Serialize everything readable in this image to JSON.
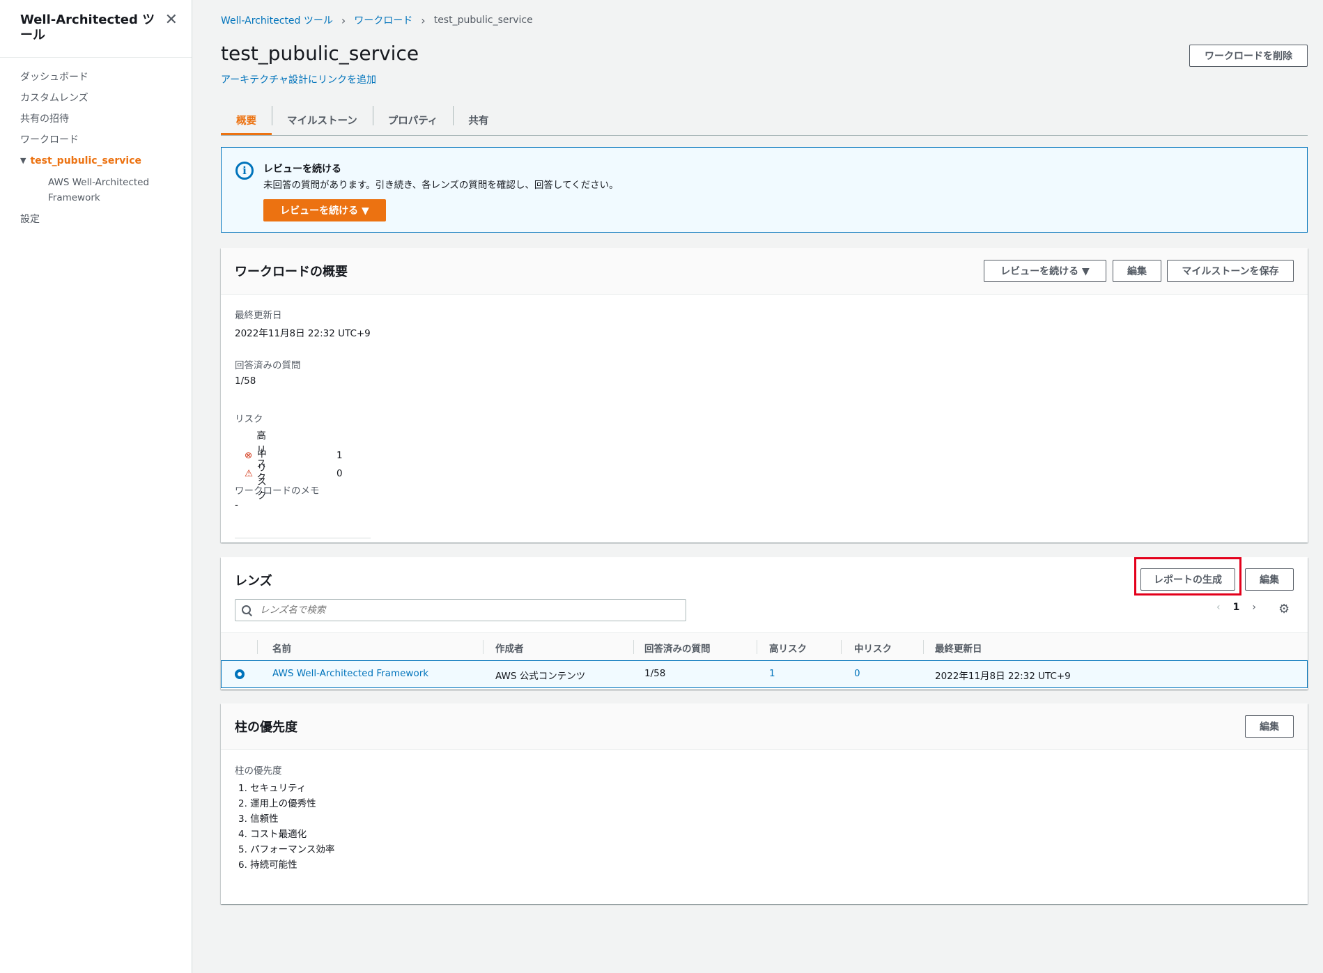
{
  "sidebar": {
    "title": "Well-Architected ツール",
    "items": [
      "ダッシュボード",
      "カスタムレンズ",
      "共有の招待",
      "ワークロード"
    ],
    "active_workload": "test_pubulic_service",
    "sub_item": "AWS Well-Architected Framework",
    "settings": "設定"
  },
  "breadcrumb": {
    "item1": "Well-Architected ツール",
    "item2": "ワークロード",
    "current": "test_pubulic_service"
  },
  "header": {
    "title": "test_pubulic_service",
    "arch_link": "アーキテクチャ設計にリンクを追加",
    "delete_button": "ワークロードを削除"
  },
  "tabs": [
    "概要",
    "マイルストーン",
    "プロパティ",
    "共有"
  ],
  "info": {
    "title": "レビューを続ける",
    "text": "未回答の質問があります。引き続き、各レンズの質問を確認し、回答してください。",
    "button": "レビューを続ける ▼"
  },
  "overview": {
    "title": "ワークロードの概要",
    "btn_continue": "レビューを続ける ▼",
    "btn_edit": "編集",
    "btn_milestone": "マイルストーンを保存",
    "updated_label": "最終更新日",
    "updated_value": "2022年11月8日 22:32 UTC+9",
    "answered_label": "回答済みの質問",
    "answered_value": "1/58",
    "risk_label": "リスク",
    "high_risk_label": "高リスク",
    "high_risk_value": "1",
    "mid_risk_label": "中リスク",
    "mid_risk_value": "0",
    "memo_label": "ワークロードのメモ",
    "memo_value": "-"
  },
  "lens": {
    "title": "レンズ",
    "btn_report": "レポートの生成",
    "btn_edit": "編集",
    "search_placeholder": "レンズ名で検索",
    "page": "1",
    "columns": [
      "名前",
      "作成者",
      "回答済みの質問",
      "高リスク",
      "中リスク",
      "最終更新日"
    ],
    "row": {
      "name": "AWS Well-Architected Framework",
      "author": "AWS 公式コンテンツ",
      "answered": "1/58",
      "high": "1",
      "mid": "0",
      "updated": "2022年11月8日 22:32 UTC+9"
    }
  },
  "pillar": {
    "title": "柱の優先度",
    "btn_edit": "編集",
    "label": "柱の優先度",
    "items": [
      "1. セキュリティ",
      "2. 運用上の優秀性",
      "3. 信頼性",
      "4. コスト最適化",
      "5. パフォーマンス効率",
      "6. 持続可能性"
    ]
  },
  "colors": {
    "accent": "#ec7211",
    "link": "#0073bb",
    "highlight": "#e3001b",
    "risk_high": "#d13212"
  }
}
